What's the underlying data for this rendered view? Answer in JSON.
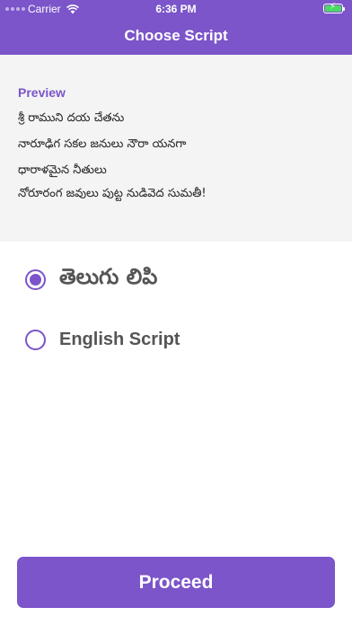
{
  "status_bar": {
    "carrier": "Carrier",
    "time": "6:36 PM",
    "wifi_icon": "wifi-icon",
    "battery_icon": "battery-charging-icon"
  },
  "nav": {
    "title": "Choose Script"
  },
  "preview": {
    "title": "Preview",
    "lines": [
      "శ్రీ రాముని దయ చేతను",
      "నారూఢిగ సకల జనులు నౌరా యనగా",
      "ధారాళమైన నీతులు",
      "నోరూరంగ జవులు పుట్ట నుడివెద సుమతీ!"
    ]
  },
  "options": [
    {
      "label": "తెలుగు లిపి",
      "selected": true
    },
    {
      "label": "English Script",
      "selected": false
    }
  ],
  "proceed_label": "Proceed",
  "colors": {
    "accent": "#7b55c9",
    "preview_bg": "#f4f4f4"
  }
}
